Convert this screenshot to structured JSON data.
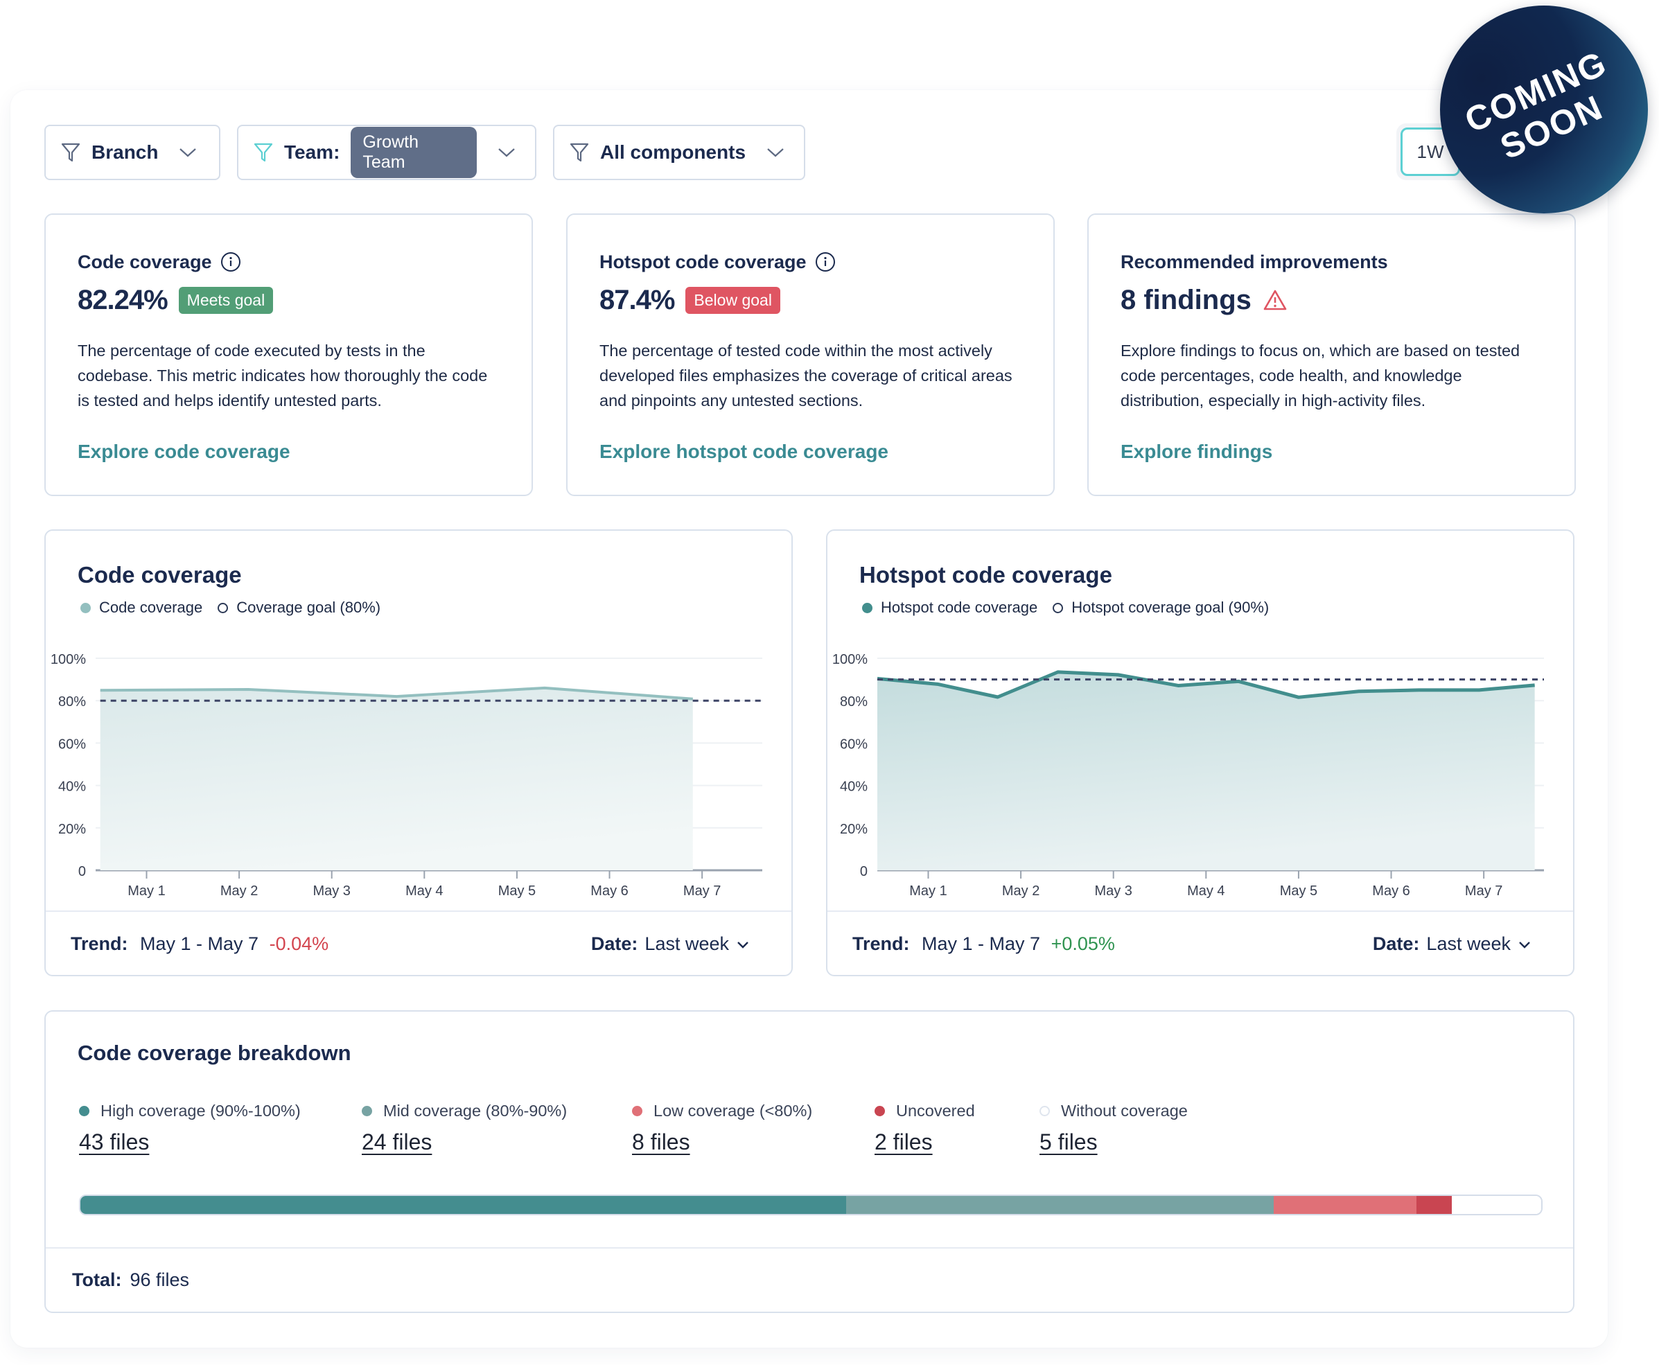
{
  "filters": {
    "branch": {
      "label": "Branch"
    },
    "team": {
      "label": "Team:",
      "value": "Growth Team"
    },
    "components": {
      "label": "All components"
    }
  },
  "period": {
    "selected": "1W"
  },
  "badge_overlay": {
    "line1": "COMING",
    "line2": "SOON"
  },
  "info_cards": [
    {
      "title": "Code coverage",
      "value": "82.24%",
      "badge": "Meets goal",
      "description": "The percentage of code executed by tests in the codebase. This metric indicates how thoroughly the code is tested and helps identify untested parts.",
      "link": "Explore code coverage"
    },
    {
      "title": "Hotspot code coverage",
      "value": "87.4%",
      "badge": "Below goal",
      "description": "The percentage of tested code within the most actively developed files emphasizes the coverage of critical areas and pinpoints any untested sections.",
      "link": "Explore hotspot code coverage"
    },
    {
      "title": "Recommended improvements",
      "value": "8 findings",
      "description": "Explore findings to focus on, which are based on tested code percentages, code health, and knowledge distribution, especially in high-activity files.",
      "link": "Explore findings"
    }
  ],
  "colors": {
    "good": "#529e76",
    "bad": "#df5562",
    "link": "#3a8b93",
    "coverage_line": "#93bfbf",
    "hotspot_line": "#428e8d",
    "goal_line": "#3d4466",
    "high": "#448d8f",
    "mid": "#77a3a3",
    "low": "#e07077",
    "uncovered": "#c94551",
    "without": "#ffffff"
  },
  "chart_data": [
    {
      "type": "area",
      "title": "Code coverage",
      "legend": [
        "Code coverage",
        "Coverage goal (80%)"
      ],
      "legend_position": "top-left",
      "categories": [
        "May 1",
        "May 2",
        "May 3",
        "May 4",
        "May 5",
        "May 6",
        "May 7"
      ],
      "yticks": [
        "0",
        "20%",
        "40%",
        "60%",
        "80%",
        "100%"
      ],
      "ylim": [
        0,
        100
      ],
      "grid": true,
      "series": [
        {
          "name": "Code coverage",
          "x": [
            0.5,
            2.1,
            3.7,
            5.3,
            6.9
          ],
          "values": [
            84.9,
            85.3,
            82.0,
            86.0,
            80.8
          ]
        }
      ],
      "goal": 80,
      "xlim": [
        0.5,
        6.9
      ],
      "trend": {
        "label": "Trend:",
        "range": "May 1 - May 7",
        "value": "-0.04%",
        "direction": "negative"
      },
      "date": {
        "label": "Date:",
        "value": "Last week"
      }
    },
    {
      "type": "area",
      "title": "Hotspot code coverage",
      "legend": [
        "Hotspot code coverage",
        "Hotspot coverage goal (90%)"
      ],
      "legend_position": "top-left",
      "categories": [
        "May 1",
        "May 2",
        "May 3",
        "May 4",
        "May 5",
        "May 6",
        "May 7"
      ],
      "yticks": [
        "0",
        "20%",
        "40%",
        "60%",
        "80%",
        "100%"
      ],
      "ylim": [
        0,
        100
      ],
      "grid": true,
      "series": [
        {
          "name": "Hotspot code coverage",
          "x": [
            0.45,
            1.1,
            1.75,
            2.4,
            3.05,
            3.7,
            4.35,
            5.0,
            5.65,
            6.3,
            6.95,
            7.55
          ],
          "values": [
            90.4,
            87.8,
            81.7,
            93.5,
            92.2,
            87.1,
            89.1,
            81.6,
            84.4,
            85.0,
            85.0,
            87.3
          ]
        }
      ],
      "goal": 90,
      "xlim": [
        0.45,
        7.55
      ],
      "trend": {
        "label": "Trend:",
        "range": "May 1 - May 7",
        "value": "+0.05%",
        "direction": "positive"
      },
      "date": {
        "label": "Date:",
        "value": "Last week"
      }
    },
    {
      "type": "bar",
      "title": "Code coverage breakdown",
      "categories": [
        "High coverage (90%-100%)",
        "Mid coverage (80%-90%)",
        "Low coverage (<80%)",
        "Uncovered",
        "Without coverage"
      ],
      "values": [
        43,
        24,
        8,
        2,
        5
      ],
      "counts_text": [
        "43 files",
        "24 files",
        "8 files",
        "2 files",
        "5 files"
      ],
      "total": {
        "label": "Total:",
        "value": "96 files"
      }
    }
  ]
}
